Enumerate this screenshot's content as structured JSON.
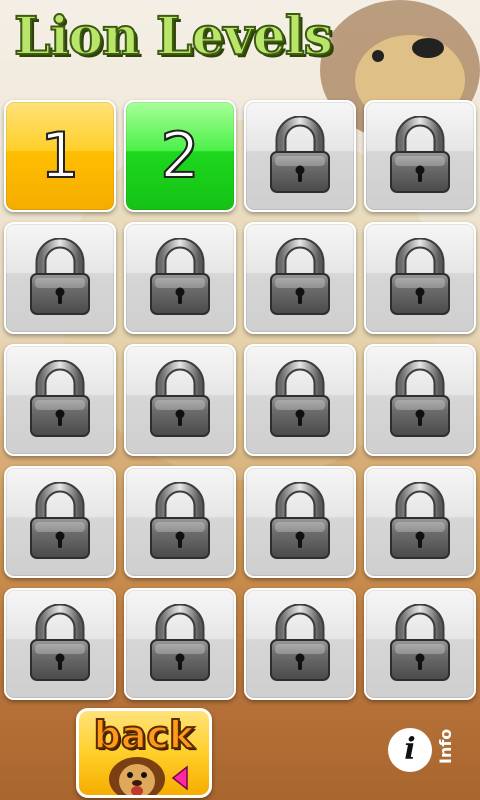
{
  "header": {
    "title": "Lion Levels"
  },
  "levels": [
    {
      "label": "1",
      "state": "unlocked",
      "color": "#ffc400"
    },
    {
      "label": "2",
      "state": "unlocked",
      "color": "#22dc22"
    },
    {
      "label": "",
      "state": "locked"
    },
    {
      "label": "",
      "state": "locked"
    },
    {
      "label": "",
      "state": "locked"
    },
    {
      "label": "",
      "state": "locked"
    },
    {
      "label": "",
      "state": "locked"
    },
    {
      "label": "",
      "state": "locked"
    },
    {
      "label": "",
      "state": "locked"
    },
    {
      "label": "",
      "state": "locked"
    },
    {
      "label": "",
      "state": "locked"
    },
    {
      "label": "",
      "state": "locked"
    },
    {
      "label": "",
      "state": "locked"
    },
    {
      "label": "",
      "state": "locked"
    },
    {
      "label": "",
      "state": "locked"
    },
    {
      "label": "",
      "state": "locked"
    },
    {
      "label": "",
      "state": "locked"
    },
    {
      "label": "",
      "state": "locked"
    },
    {
      "label": "",
      "state": "locked"
    },
    {
      "label": "",
      "state": "locked"
    }
  ],
  "footer": {
    "back_label": "back",
    "back_icon": "lion-face-icon",
    "info_label": "Info",
    "info_icon_glyph": "i"
  },
  "colors": {
    "title_fill": "#b9e66a",
    "title_outline": "#3d5a10",
    "back_text": "#ff9a1a",
    "arrow": "#ff2aa0"
  }
}
